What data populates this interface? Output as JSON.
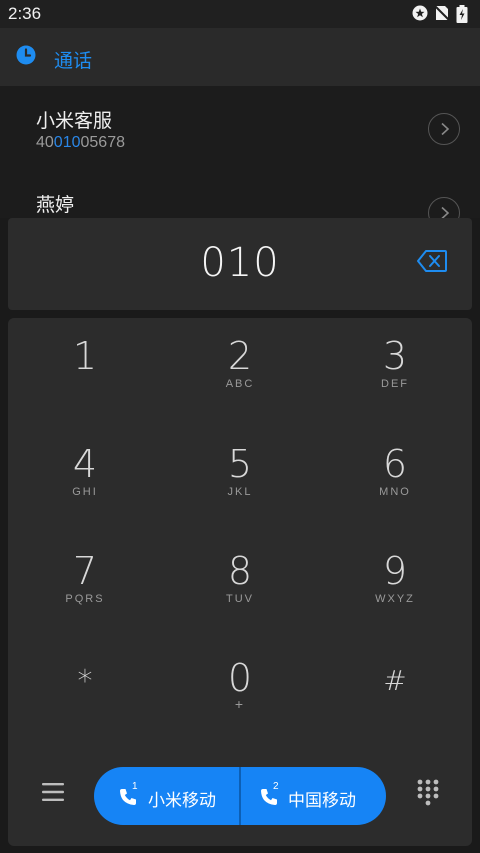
{
  "status_bar": {
    "time": "2:36",
    "icons": [
      "notification-icon",
      "no-sim-icon",
      "battery-charging-icon"
    ]
  },
  "header": {
    "title": "通话",
    "icon": "clock-icon",
    "accent_color": "#1e8cf0"
  },
  "contacts": [
    {
      "name": "小米客服",
      "number_prefix": "40",
      "number_match": "010",
      "number_suffix": "05678"
    },
    {
      "name": "燕婷",
      "number_prefix": "",
      "number_match": "",
      "number_suffix": ""
    }
  ],
  "input": {
    "value": "010"
  },
  "keypad": {
    "keys": [
      {
        "digit": "1",
        "letters": ""
      },
      {
        "digit": "2",
        "letters": "ABC"
      },
      {
        "digit": "3",
        "letters": "DEF"
      },
      {
        "digit": "4",
        "letters": "GHI"
      },
      {
        "digit": "5",
        "letters": "JKL"
      },
      {
        "digit": "6",
        "letters": "MNO"
      },
      {
        "digit": "7",
        "letters": "PQRS"
      },
      {
        "digit": "8",
        "letters": "TUV"
      },
      {
        "digit": "9",
        "letters": "WXYZ"
      },
      {
        "digit": "*",
        "letters": ""
      },
      {
        "digit": "0",
        "letters": "+"
      },
      {
        "digit": "#",
        "letters": ""
      }
    ]
  },
  "dial": {
    "sim1_label": "小米移动",
    "sim1_index": "1",
    "sim2_label": "中国移动",
    "sim2_index": "2",
    "button_color": "#1684f5"
  }
}
